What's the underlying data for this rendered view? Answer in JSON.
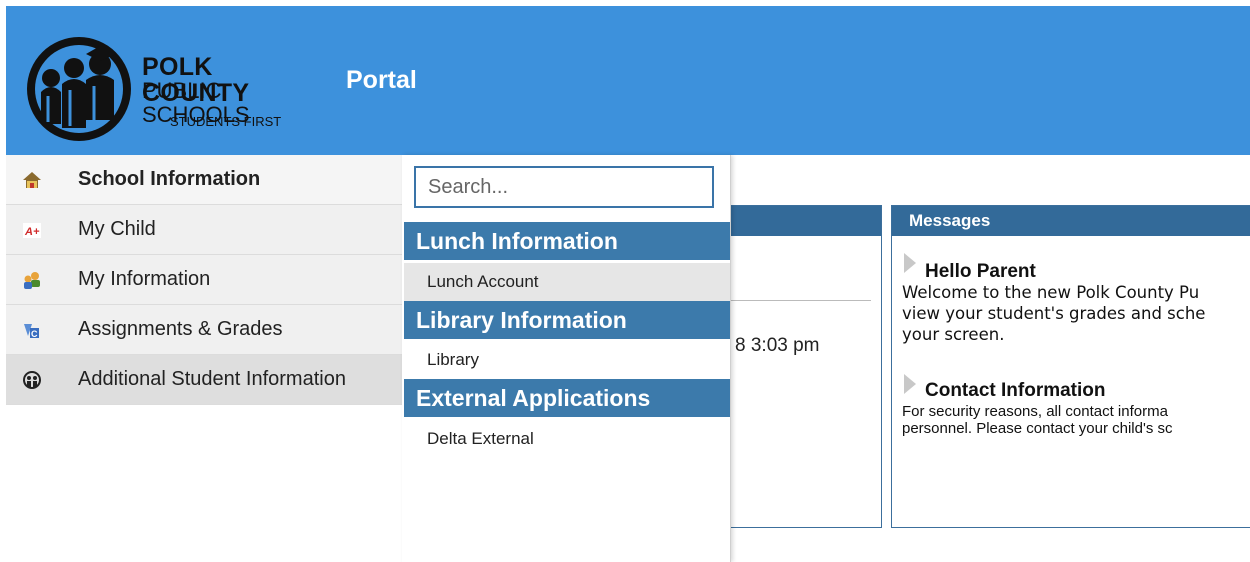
{
  "header": {
    "logo": {
      "line1": "POLK COUNTY",
      "line2": "PUBLIC SCHOOLS",
      "line3": "STUDENTS FIRST"
    },
    "title": "Portal",
    "background_color": "#3d91dc"
  },
  "sidebar": {
    "items": [
      {
        "label": "School Information",
        "icon": "house-icon",
        "state": "active"
      },
      {
        "label": "My Child",
        "icon": "grade-a-plus-icon"
      },
      {
        "label": "My Information",
        "icon": "people-icon"
      },
      {
        "label": "Assignments & Grades",
        "icon": "abc-icon"
      },
      {
        "label": "Additional Student Information",
        "icon": "students-group-icon",
        "state": "hover"
      }
    ]
  },
  "flyout": {
    "search_placeholder": "Search...",
    "categories": [
      {
        "heading": "Lunch Information",
        "items": [
          "Lunch Account"
        ]
      },
      {
        "heading": "Library Information",
        "items": [
          "Library"
        ]
      },
      {
        "heading": "External Applications",
        "items": [
          "Delta External"
        ]
      }
    ]
  },
  "panels": {
    "left": {
      "timestamp": "8 3:03 pm"
    },
    "messages": {
      "heading": "Messages",
      "items": [
        {
          "title": "Hello Parent",
          "body_lines": [
            "Welcome to the new Polk County Pu",
            "view your student's grades and sche",
            "your screen."
          ]
        },
        {
          "title": "Contact Information",
          "body_lines": [
            "For security reasons, all contact informa",
            "personnel. Please contact your child's sc"
          ]
        }
      ]
    }
  },
  "colors": {
    "accent": "#3c7aab",
    "panel_head": "#336a99"
  }
}
